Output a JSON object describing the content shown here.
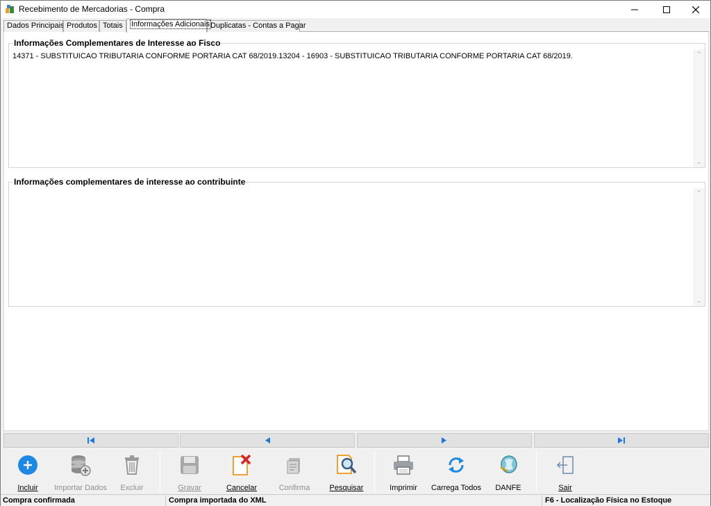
{
  "window": {
    "title": "Recebimento de Mercadorias - Compra"
  },
  "tabs": [
    {
      "label": "Dados Principais"
    },
    {
      "label": "Produtos"
    },
    {
      "label": "Totais"
    },
    {
      "label": "Informações Adicionais",
      "active": true
    },
    {
      "label": "Duplicatas - Contas a Pagar"
    }
  ],
  "fisco": {
    "label": "Informações Complementares de Interesse ao Fisco",
    "value": "14371 - SUBSTITUICAO TRIBUTARIA CONFORME PORTARIA CAT 68/2019.13204 - 16903 - SUBSTITUICAO TRIBUTARIA CONFORME PORTARIA CAT 68/2019."
  },
  "contribuinte": {
    "label": "Informações complementares de interesse ao contribuinte",
    "value": ""
  },
  "toolbar": {
    "incluir": "Incluir",
    "importar": "Importar Dados",
    "excluir": "Excluir",
    "gravar": "Gravar",
    "cancelar": "Cancelar",
    "confirma": "Confirma",
    "pesquisar": "Pesquisar",
    "imprimir": "Imprimir",
    "carrega": "Carrega Todos",
    "danfe": "DANFE",
    "sair": "Sair"
  },
  "status": {
    "left": "Compra confirmada",
    "middle": "Compra importada do XML",
    "right": "F6 - Localização Física no Estoque"
  },
  "colors": {
    "accent_blue": "#1e78d7",
    "cancel_red": "#e02020",
    "search_orange": "#f0a030"
  }
}
